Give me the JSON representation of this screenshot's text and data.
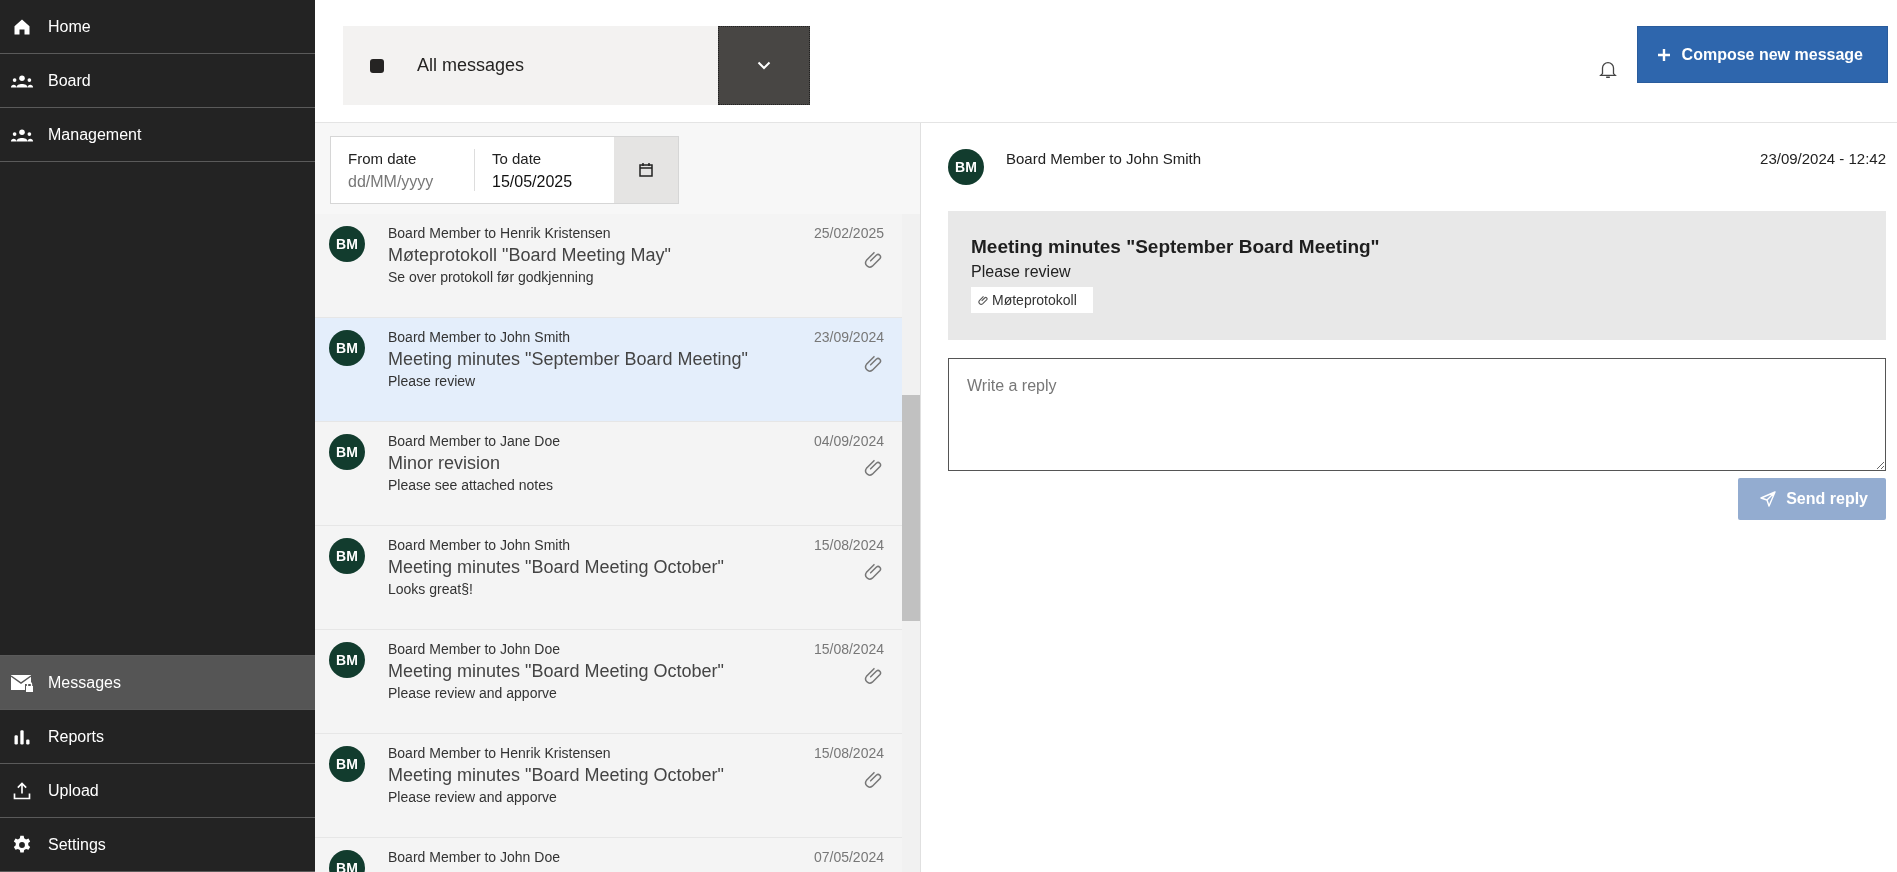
{
  "sidebar": {
    "items": [
      {
        "label": "Home",
        "selected": false
      },
      {
        "label": "Board",
        "selected": false
      },
      {
        "label": "Management",
        "selected": false
      },
      {
        "label": "Messages",
        "selected": true
      },
      {
        "label": "Reports",
        "selected": false
      },
      {
        "label": "Upload",
        "selected": false
      },
      {
        "label": "Settings",
        "selected": false
      }
    ]
  },
  "filter": {
    "label": "All messages"
  },
  "compose_button": "Compose new message",
  "date_range": {
    "from_label": "From date",
    "from_placeholder": "dd/MM/yyyy",
    "to_label": "To date",
    "to_value": "15/05/2025"
  },
  "messages": [
    {
      "avatar": "BM",
      "sender": "Board Member to Henrik Kristensen",
      "subject": "Møteprotokoll \"Board Meeting May\"",
      "preview": "Se over protokoll før godkjenning",
      "date": "25/02/2025",
      "attachment": true,
      "selected": false
    },
    {
      "avatar": "BM",
      "sender": "Board Member to John Smith",
      "subject": "Meeting minutes \"September Board Meeting\"",
      "preview": "Please review",
      "date": "23/09/2024",
      "attachment": true,
      "selected": true
    },
    {
      "avatar": "BM",
      "sender": "Board Member to Jane Doe",
      "subject": "Minor revision",
      "preview": "Please see attached notes",
      "date": "04/09/2024",
      "attachment": true,
      "selected": false
    },
    {
      "avatar": "BM",
      "sender": "Board Member to John Smith",
      "subject": "Meeting minutes \"Board Meeting October\"",
      "preview": "Looks great§!",
      "date": "15/08/2024",
      "attachment": true,
      "selected": false
    },
    {
      "avatar": "BM",
      "sender": "Board Member to John Doe",
      "subject": "Meeting minutes \"Board Meeting October\"",
      "preview": "Please review and apporve",
      "date": "15/08/2024",
      "attachment": true,
      "selected": false
    },
    {
      "avatar": "BM",
      "sender": "Board Member to Henrik Kristensen",
      "subject": "Meeting minutes \"Board Meeting October\"",
      "preview": "Please review and apporve",
      "date": "15/08/2024",
      "attachment": true,
      "selected": false
    },
    {
      "avatar": "BM",
      "sender": "Board Member to John Doe",
      "date": "07/05/2024",
      "selected": false
    }
  ],
  "detail": {
    "avatar": "BM",
    "sender": "Board Member to John Smith",
    "timestamp": "23/09/2024 - 12:42",
    "subject": "Meeting minutes \"September Board Meeting\"",
    "body": "Please review",
    "attachments": [
      "Møteprotokoll"
    ]
  },
  "reply": {
    "placeholder": "Write a reply",
    "send_button": "Send reply",
    "disabled": true
  }
}
